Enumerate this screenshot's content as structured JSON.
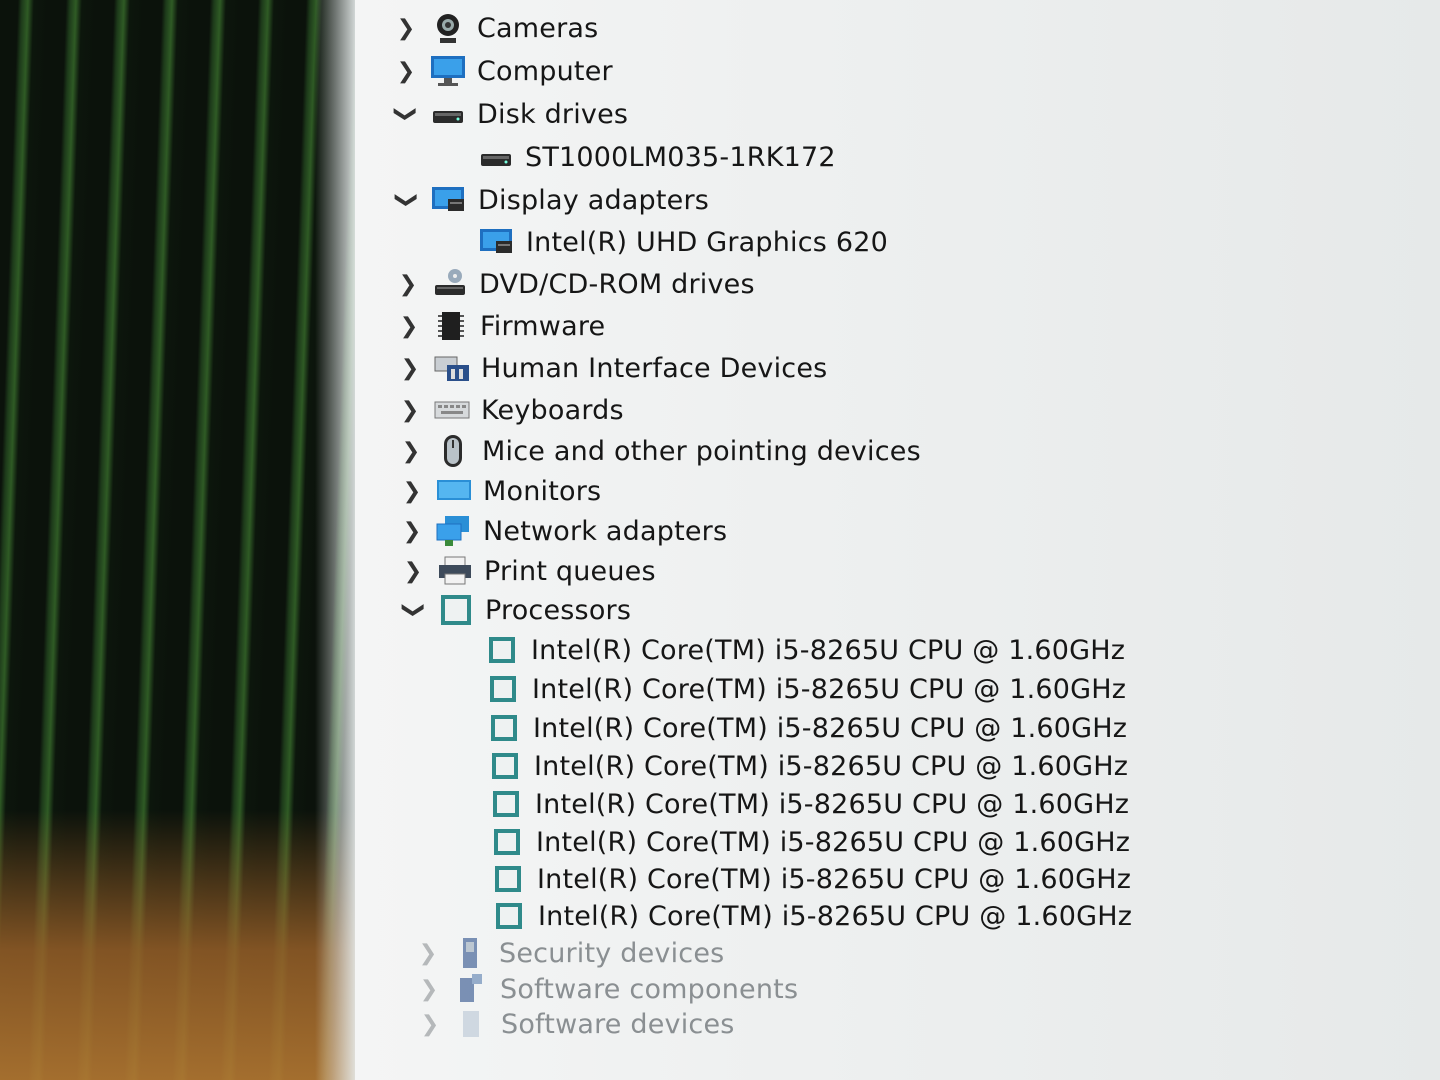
{
  "tree": {
    "categories": [
      {
        "label": "Cameras",
        "expanded": false,
        "icon": "camera-icon"
      },
      {
        "label": "Computer",
        "expanded": false,
        "icon": "monitor-icon"
      },
      {
        "label": "Disk drives",
        "expanded": true,
        "icon": "disk-drive-icon"
      },
      {
        "label": "ST1000LM035-1RK172",
        "child": true,
        "icon": "disk-drive-icon"
      },
      {
        "label": "Display adapters",
        "expanded": true,
        "icon": "display-adapter-icon"
      },
      {
        "label": "Intel(R) UHD Graphics 620",
        "child": true,
        "icon": "display-adapter-icon"
      },
      {
        "label": "DVD/CD-ROM drives",
        "expanded": false,
        "icon": "dvd-drive-icon"
      },
      {
        "label": "Firmware",
        "expanded": false,
        "icon": "firmware-chip-icon"
      },
      {
        "label": "Human Interface Devices",
        "expanded": false,
        "icon": "hid-icon"
      },
      {
        "label": "Keyboards",
        "expanded": false,
        "icon": "keyboard-icon"
      },
      {
        "label": "Mice and other pointing devices",
        "expanded": false,
        "icon": "mouse-icon"
      },
      {
        "label": "Monitors",
        "expanded": false,
        "icon": "monitor-icon"
      },
      {
        "label": "Network adapters",
        "expanded": false,
        "icon": "network-adapter-icon"
      },
      {
        "label": "Print queues",
        "expanded": false,
        "icon": "printer-icon"
      },
      {
        "label": "Processors",
        "expanded": true,
        "icon": "processor-icon"
      },
      {
        "label": "Intel(R) Core(TM) i5-8265U CPU @ 1.60GHz",
        "child": true,
        "icon": "processor-icon"
      },
      {
        "label": "Intel(R) Core(TM) i5-8265U CPU @ 1.60GHz",
        "child": true,
        "icon": "processor-icon"
      },
      {
        "label": "Intel(R) Core(TM) i5-8265U CPU @ 1.60GHz",
        "child": true,
        "icon": "processor-icon"
      },
      {
        "label": "Intel(R) Core(TM) i5-8265U CPU @ 1.60GHz",
        "child": true,
        "icon": "processor-icon"
      },
      {
        "label": "Intel(R) Core(TM) i5-8265U CPU @ 1.60GHz",
        "child": true,
        "icon": "processor-icon"
      },
      {
        "label": "Intel(R) Core(TM) i5-8265U CPU @ 1.60GHz",
        "child": true,
        "icon": "processor-icon"
      },
      {
        "label": "Intel(R) Core(TM) i5-8265U CPU @ 1.60GHz",
        "child": true,
        "icon": "processor-icon"
      },
      {
        "label": "Intel(R) Core(TM) i5-8265U CPU @ 1.60GHz",
        "child": true,
        "icon": "processor-icon"
      },
      {
        "label": "Security devices",
        "expanded": false,
        "icon": "security-device-icon"
      },
      {
        "label": "Software components",
        "expanded": false,
        "icon": "software-component-icon"
      },
      {
        "label": "Software devices",
        "expanded": false,
        "icon": "software-device-icon"
      }
    ]
  },
  "colors": {
    "processor_accent": "#2f8a8a",
    "monitor_blue": "#2a8fd6"
  }
}
